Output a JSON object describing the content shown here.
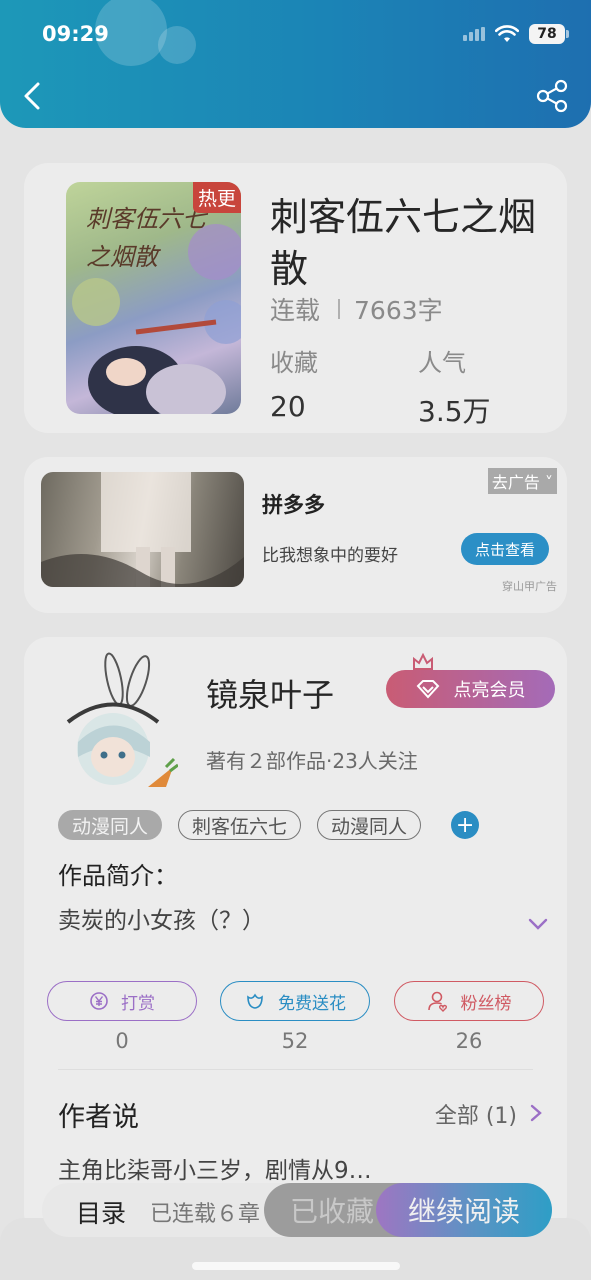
{
  "status_bar": {
    "time": "09:29",
    "battery": "78"
  },
  "book": {
    "title": "刺客伍六七之烟散",
    "status": "连载",
    "word_count": "7663字",
    "cover_badge": "热更",
    "cover_title": "刺客伍六七之烟散",
    "favorites_label": "收藏",
    "favorites_value": "20",
    "popularity_label": "人气",
    "popularity_value": "3.5万"
  },
  "ad": {
    "brand": "拼多多",
    "description": "比我想象中的要好",
    "close_label": "去广告",
    "cta": "点击查看",
    "source": "穿山甲广告"
  },
  "author": {
    "name": "镜泉叶子",
    "vip_label": "点亮会员",
    "stats": "著有２部作品·23人关注",
    "tags": [
      "动漫同人",
      "刺客伍六七",
      "动漫同人"
    ],
    "intro_title": "作品简介：",
    "intro_text": "卖炭的小女孩（？）",
    "actions": [
      {
        "label": "打赏",
        "count": "0",
        "color": "#9b6fc6"
      },
      {
        "label": "免费送花",
        "count": "52",
        "color": "#2a8dc3"
      },
      {
        "label": "粉丝榜",
        "count": "26",
        "color": "#d05a63"
      }
    ],
    "says_title": "作者说",
    "says_all": "全部 (1)",
    "says_text": "主角比柒哥小三岁，剧情从9…"
  },
  "bottom_bar": {
    "toc": "目录",
    "serial": "已连载６章",
    "collected": "已收藏",
    "continue": "继续阅读"
  },
  "icons": [
    "back-icon",
    "share-icon",
    "wifi-icon",
    "signal-icon",
    "diamond-icon",
    "crown-icon",
    "plus-icon",
    "chevron-down-icon",
    "chevron-right-icon",
    "yen-icon",
    "flower-icon",
    "fans-icon"
  ]
}
